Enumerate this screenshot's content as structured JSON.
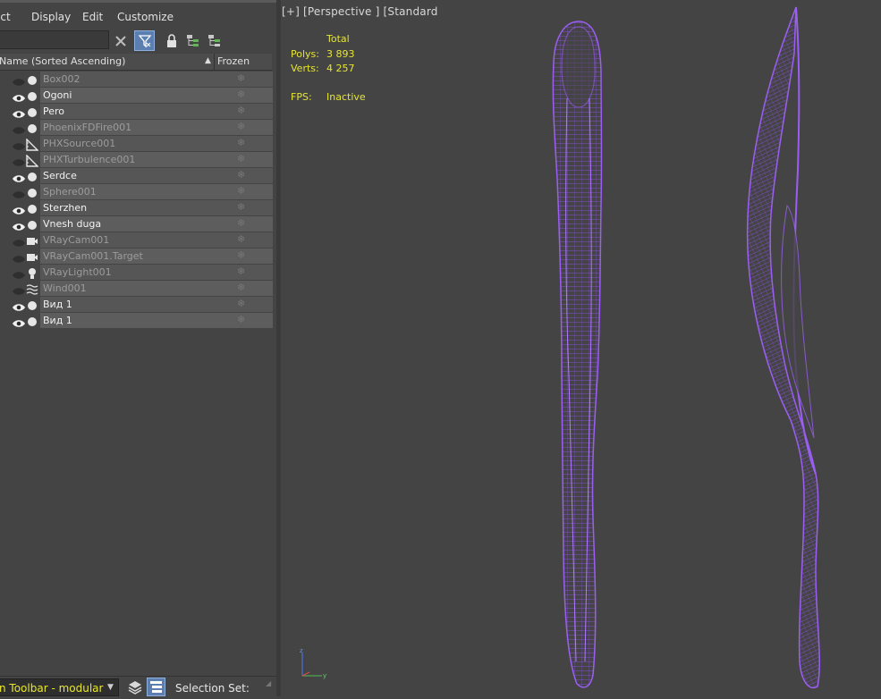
{
  "menu": {
    "select": "ect",
    "display": "Display",
    "edit": "Edit",
    "customize": "Customize"
  },
  "toolbar": {
    "search_value": "",
    "icons": [
      "clear-icon",
      "filter-icon",
      "lock-icon",
      "hierarchy-icon",
      "hierarchy-icon"
    ]
  },
  "columns": {
    "name": "Name (Sorted Ascending)",
    "frozen": "Frozen"
  },
  "objects": [
    {
      "name": "Box002",
      "visible": false,
      "type": "geometry"
    },
    {
      "name": "Ogoni",
      "visible": true,
      "type": "geometry"
    },
    {
      "name": "Pero",
      "visible": true,
      "type": "geometry"
    },
    {
      "name": "PhoenixFDFire001",
      "visible": false,
      "type": "geometry"
    },
    {
      "name": "PHXSource001",
      "visible": false,
      "type": "helper"
    },
    {
      "name": "PHXTurbulence001",
      "visible": false,
      "type": "helper"
    },
    {
      "name": "Serdce",
      "visible": true,
      "type": "geometry"
    },
    {
      "name": "Sphere001",
      "visible": false,
      "type": "geometry"
    },
    {
      "name": "Sterzhen",
      "visible": true,
      "type": "geometry"
    },
    {
      "name": "Vnesh duga",
      "visible": true,
      "type": "geometry"
    },
    {
      "name": "VRayCam001",
      "visible": false,
      "type": "camera"
    },
    {
      "name": "VRayCam001.Target",
      "visible": false,
      "type": "camera"
    },
    {
      "name": "VRayLight001",
      "visible": false,
      "type": "light"
    },
    {
      "name": "Wind001",
      "visible": false,
      "type": "spacewarp"
    },
    {
      "name": "Вид 1",
      "visible": true,
      "type": "geometry"
    },
    {
      "name": "Вид 1",
      "visible": true,
      "type": "geometry"
    }
  ],
  "bottom": {
    "layer_toolbar": "n Toolbar - modular",
    "selection_set": "Selection Set:"
  },
  "viewport": {
    "label": "[+] [Perspective ] [Standard",
    "total_label": "Total",
    "polys_label": "Polys:",
    "polys_value": "3 893",
    "verts_label": "Verts:",
    "verts_value": "4 257",
    "fps_label": "FPS:",
    "fps_value": "Inactive",
    "wire_color": "#8a4fe0"
  },
  "colors": {
    "stat_text": "#e5e533",
    "selection_blue": "#5a7fb0"
  }
}
